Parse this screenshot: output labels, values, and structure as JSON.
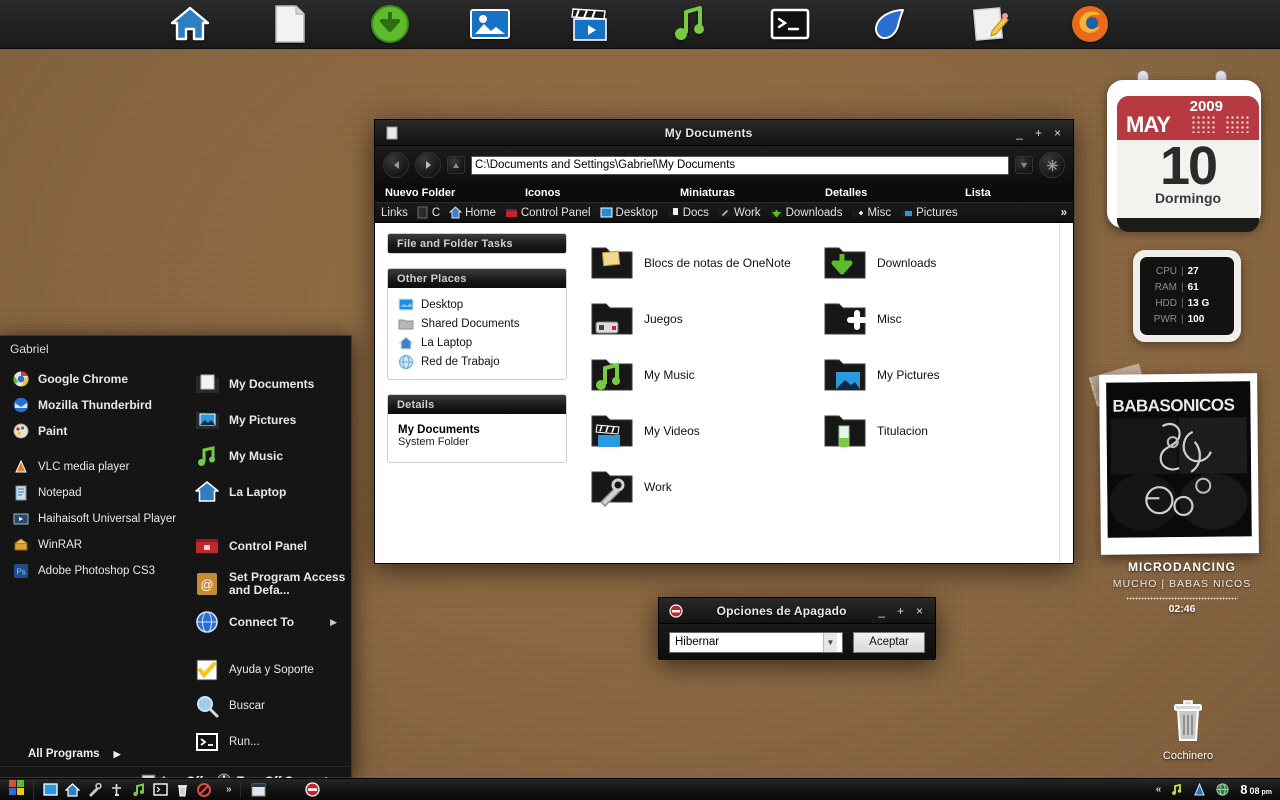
{
  "dock": {
    "items": [
      {
        "name": "home-icon",
        "label": "Home"
      },
      {
        "name": "document-icon",
        "label": "Documents"
      },
      {
        "name": "download-icon",
        "label": "Downloads"
      },
      {
        "name": "pictures-icon",
        "label": "Pictures"
      },
      {
        "name": "movies-icon",
        "label": "Videos"
      },
      {
        "name": "music-icon",
        "label": "Music"
      },
      {
        "name": "terminal-icon",
        "label": "Terminal"
      },
      {
        "name": "photoshop-feather-icon",
        "label": "Photoshop"
      },
      {
        "name": "notepad-icon",
        "label": "Notepad"
      },
      {
        "name": "firefox-icon",
        "label": "Firefox"
      }
    ]
  },
  "explorer": {
    "title": "My Documents",
    "window_buttons": {
      "minimize": "_",
      "maximize": "+",
      "close": "×"
    },
    "address": "C:\\Documents and Settings\\Gabriel\\My Documents",
    "views": [
      "Nuevo Folder",
      "Iconos",
      "Miniaturas",
      "Detalles",
      "Lista"
    ],
    "links_label": "Links",
    "links": [
      {
        "label": "C",
        "icon": "drive-icon"
      },
      {
        "label": "Home",
        "icon": "home-icon"
      },
      {
        "label": "Control Panel",
        "icon": "control-panel-icon"
      },
      {
        "label": "Desktop",
        "icon": "desktop-icon"
      },
      {
        "label": "Docs",
        "icon": "docs-folder-icon"
      },
      {
        "label": "Work",
        "icon": "work-folder-icon"
      },
      {
        "label": "Downloads",
        "icon": "downloads-folder-icon"
      },
      {
        "label": "Misc",
        "icon": "misc-folder-icon"
      },
      {
        "label": "Pictures",
        "icon": "pictures-folder-icon"
      }
    ],
    "links_overflow": "»",
    "panels": {
      "file_tasks": {
        "title": "File and Folder Tasks"
      },
      "other_places": {
        "title": "Other Places",
        "items": [
          {
            "label": "Desktop",
            "icon": "desktop-icon"
          },
          {
            "label": "Shared Documents",
            "icon": "shared-folder-icon"
          },
          {
            "label": "La Laptop",
            "icon": "computer-home-icon"
          },
          {
            "label": "Red de Trabajo",
            "icon": "network-icon"
          }
        ]
      },
      "details": {
        "title": "Details",
        "name": "My Documents",
        "type": "System Folder"
      }
    },
    "files": [
      {
        "label": "Blocs de notas de OneNote",
        "icon": "onenote-folder-icon"
      },
      {
        "label": "Downloads",
        "icon": "downloads-folder-icon"
      },
      {
        "label": "Juegos",
        "icon": "games-folder-icon"
      },
      {
        "label": "Misc",
        "icon": "misc-folder-icon"
      },
      {
        "label": "My Music",
        "icon": "music-folder-icon"
      },
      {
        "label": "My Pictures",
        "icon": "pictures-folder-icon"
      },
      {
        "label": "My Videos",
        "icon": "videos-folder-icon"
      },
      {
        "label": "Titulacion",
        "icon": "beaker-folder-icon"
      },
      {
        "label": "Work",
        "icon": "work-folder-icon"
      }
    ]
  },
  "shutdown_dialog": {
    "title": "Opciones de Apagado",
    "window_buttons": {
      "minimize": "_",
      "maximize": "+",
      "close": "×"
    },
    "selected_option": "Hibernar",
    "ok_label": "Aceptar"
  },
  "start_menu": {
    "user": "Gabriel",
    "left_items": [
      {
        "label": "Google Chrome",
        "icon": "chrome-icon",
        "bold": true
      },
      {
        "label": "Mozilla Thunderbird",
        "icon": "thunderbird-icon",
        "bold": true
      },
      {
        "label": "Paint",
        "icon": "paint-icon",
        "bold": true
      },
      {
        "label": "VLC media player",
        "icon": "vlc-icon",
        "bold": false
      },
      {
        "label": "Notepad",
        "icon": "notepad-icon",
        "bold": false
      },
      {
        "label": "Haihaisoft Universal Player",
        "icon": "haihaisoft-icon",
        "bold": false
      },
      {
        "label": "WinRAR",
        "icon": "winrar-icon",
        "bold": false
      },
      {
        "label": "Adobe Photoshop CS3",
        "icon": "photoshop-icon",
        "bold": false
      }
    ],
    "right_items": [
      {
        "label": "My Documents",
        "icon": "my-documents-icon",
        "arrow": false
      },
      {
        "label": "My Pictures",
        "icon": "my-pictures-icon",
        "arrow": false
      },
      {
        "label": "My Music",
        "icon": "my-music-icon",
        "arrow": false
      },
      {
        "label": "La Laptop",
        "icon": "my-computer-icon",
        "arrow": false
      },
      {
        "label": "Control Panel",
        "icon": "control-panel-icon",
        "arrow": false
      },
      {
        "label": "Set Program Access and Defa...",
        "icon": "set-program-access-icon",
        "arrow": false
      },
      {
        "label": "Connect To",
        "icon": "connect-to-icon",
        "arrow": true
      },
      {
        "label": "Ayuda y Soporte",
        "icon": "help-icon",
        "arrow": false
      },
      {
        "label": "Buscar",
        "icon": "search-icon",
        "arrow": false
      },
      {
        "label": "Run...",
        "icon": "run-icon",
        "arrow": false
      }
    ],
    "all_programs": "All Programs",
    "all_programs_arrow": "▶",
    "log_off": "Log Off",
    "turn_off": "Turn Off Computer"
  },
  "calendar": {
    "year": "2009",
    "month": "MAY",
    "day": "10",
    "weekday": "Dormingo"
  },
  "system_monitor": {
    "rows": [
      {
        "key": "CPU",
        "value": "27"
      },
      {
        "key": "RAM",
        "value": "61"
      },
      {
        "key": "HDD",
        "value": "13 G"
      },
      {
        "key": "PWR",
        "value": "100"
      }
    ],
    "separator": "|"
  },
  "now_playing": {
    "cover_text": "BABASONICOS",
    "title": "MICRODANCING",
    "subtitle": "MUCHO | BABAS NICOS",
    "time": "02:46"
  },
  "recycle_bin": {
    "label": "Cochinero",
    "icon": "trash-icon"
  },
  "taskbar": {
    "start_icon": "windows-start-icon",
    "quick_launch": [
      {
        "name": "show-desktop-icon"
      },
      {
        "name": "home-icon"
      },
      {
        "name": "tools-icon"
      },
      {
        "name": "add-icon"
      },
      {
        "name": "music-icon"
      },
      {
        "name": "terminal-icon"
      },
      {
        "name": "trash-icon"
      },
      {
        "name": "block-icon"
      }
    ],
    "overflow": "»",
    "tasks": [
      {
        "name": "explorer-task",
        "icon": "window-icon"
      },
      {
        "name": "shutdown-task",
        "icon": "shutdown-icon"
      }
    ],
    "tray_expand": "«",
    "tray": [
      {
        "name": "music-tray-icon"
      },
      {
        "name": "vlc-tray-icon"
      },
      {
        "name": "network-tray-icon"
      }
    ],
    "clock": {
      "hour": "8",
      "minute": "08",
      "ampm": "pm"
    }
  }
}
